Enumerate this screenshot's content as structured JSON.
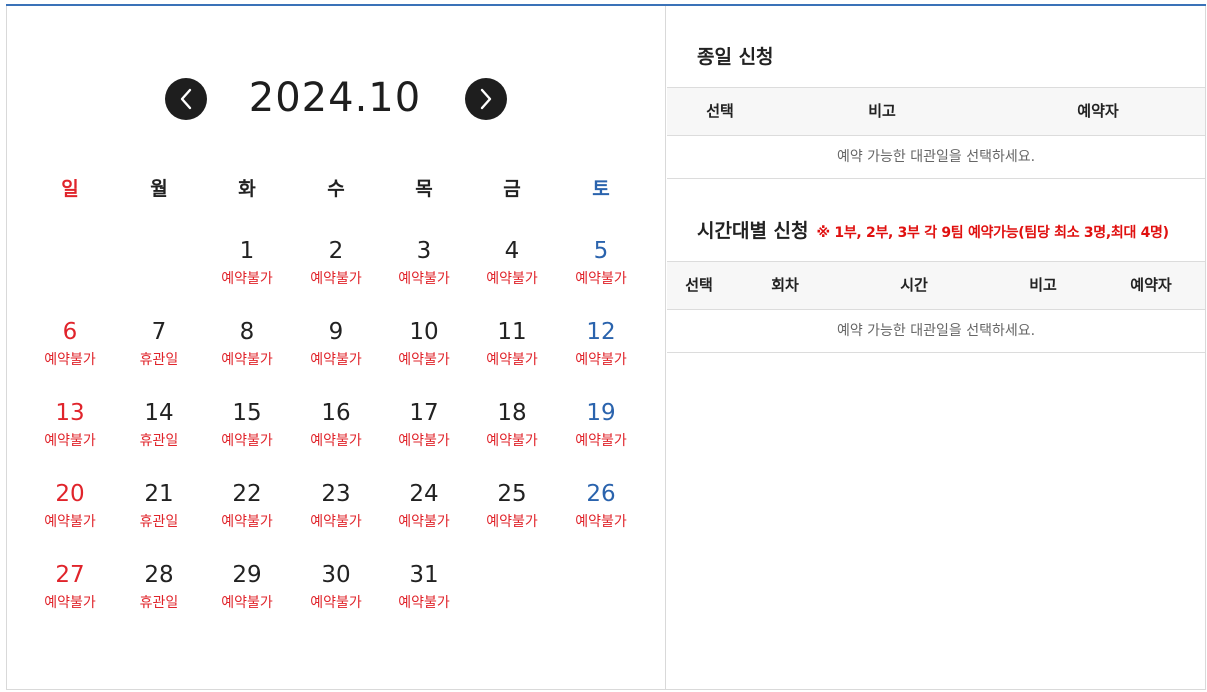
{
  "calendar": {
    "title": "2024.10",
    "prev_label": "이전 달",
    "next_label": "다음 달",
    "weekdays": [
      "일",
      "월",
      "화",
      "수",
      "목",
      "금",
      "토"
    ],
    "weeks": [
      [
        null,
        null,
        {
          "day": "1",
          "status": "예약불가"
        },
        {
          "day": "2",
          "status": "예약불가"
        },
        {
          "day": "3",
          "status": "예약불가"
        },
        {
          "day": "4",
          "status": "예약불가"
        },
        {
          "day": "5",
          "status": "예약불가"
        }
      ],
      [
        {
          "day": "6",
          "status": "예약불가"
        },
        {
          "day": "7",
          "status": "휴관일"
        },
        {
          "day": "8",
          "status": "예약불가"
        },
        {
          "day": "9",
          "status": "예약불가"
        },
        {
          "day": "10",
          "status": "예약불가"
        },
        {
          "day": "11",
          "status": "예약불가"
        },
        {
          "day": "12",
          "status": "예약불가"
        }
      ],
      [
        {
          "day": "13",
          "status": "예약불가"
        },
        {
          "day": "14",
          "status": "휴관일"
        },
        {
          "day": "15",
          "status": "예약불가"
        },
        {
          "day": "16",
          "status": "예약불가"
        },
        {
          "day": "17",
          "status": "예약불가"
        },
        {
          "day": "18",
          "status": "예약불가"
        },
        {
          "day": "19",
          "status": "예약불가"
        }
      ],
      [
        {
          "day": "20",
          "status": "예약불가"
        },
        {
          "day": "21",
          "status": "휴관일"
        },
        {
          "day": "22",
          "status": "예약불가"
        },
        {
          "day": "23",
          "status": "예약불가"
        },
        {
          "day": "24",
          "status": "예약불가"
        },
        {
          "day": "25",
          "status": "예약불가"
        },
        {
          "day": "26",
          "status": "예약불가"
        }
      ],
      [
        {
          "day": "27",
          "status": "예약불가"
        },
        {
          "day": "28",
          "status": "휴관일"
        },
        {
          "day": "29",
          "status": "예약불가"
        },
        {
          "day": "30",
          "status": "예약불가"
        },
        {
          "day": "31",
          "status": "예약불가"
        },
        null,
        null
      ]
    ]
  },
  "full_day": {
    "title": "종일 신청",
    "columns": [
      "선택",
      "비고",
      "예약자"
    ],
    "empty_message": "예약 가능한 대관일을 선택하세요."
  },
  "time_slot": {
    "title": "시간대별 신청",
    "note": "※ 1부, 2부, 3부 각 9팀 예약가능(팀당 최소 3명,최대 4명)",
    "columns": [
      "선택",
      "회차",
      "시간",
      "비고",
      "예약자"
    ],
    "empty_message": "예약 가능한 대관일을 선택하세요."
  },
  "colors": {
    "accent_line": "#3a72b8",
    "sunday": "#e0242b",
    "saturday": "#2a63ad",
    "unavailable": "#e0242b",
    "note": "#e0100f"
  }
}
